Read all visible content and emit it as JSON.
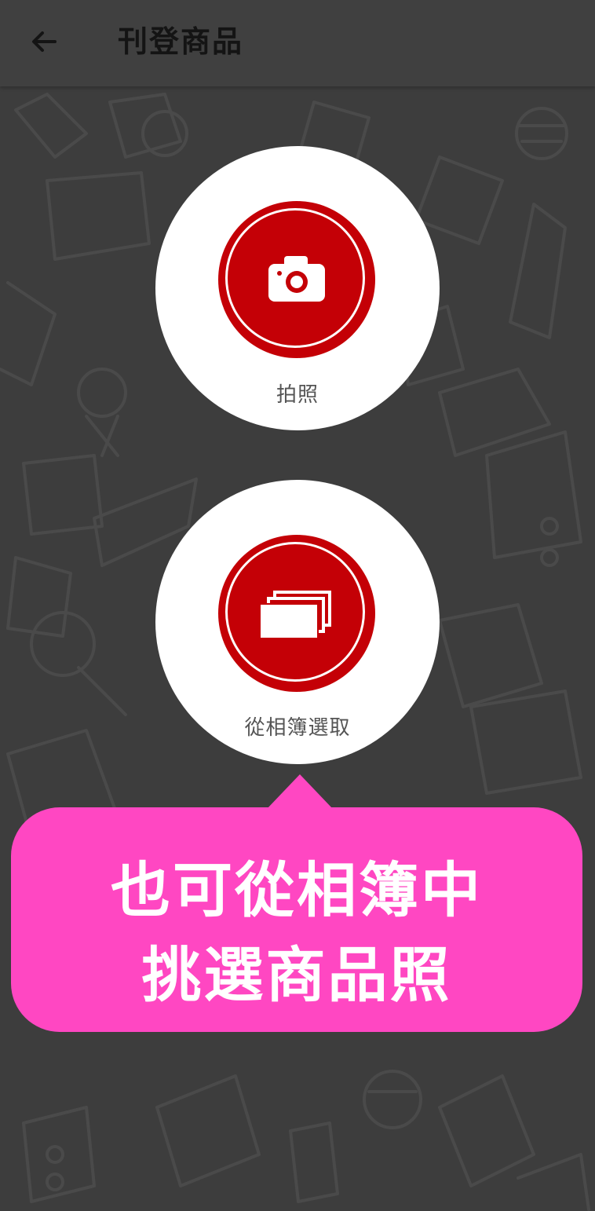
{
  "header": {
    "title": "刊登商品",
    "back_icon": "arrow-left-icon"
  },
  "options": [
    {
      "label": "拍照",
      "icon": "camera-icon"
    },
    {
      "label": "從相簿選取",
      "icon": "photo-stack-icon"
    }
  ],
  "callout": {
    "line1": "也可從相簿中",
    "line2": "挑選商品照"
  },
  "colors": {
    "background": "#3d3d3d",
    "header": "#404040",
    "accent_red": "#c40006",
    "callout_pink": "#ff47c2",
    "text_white": "#ffffff"
  }
}
